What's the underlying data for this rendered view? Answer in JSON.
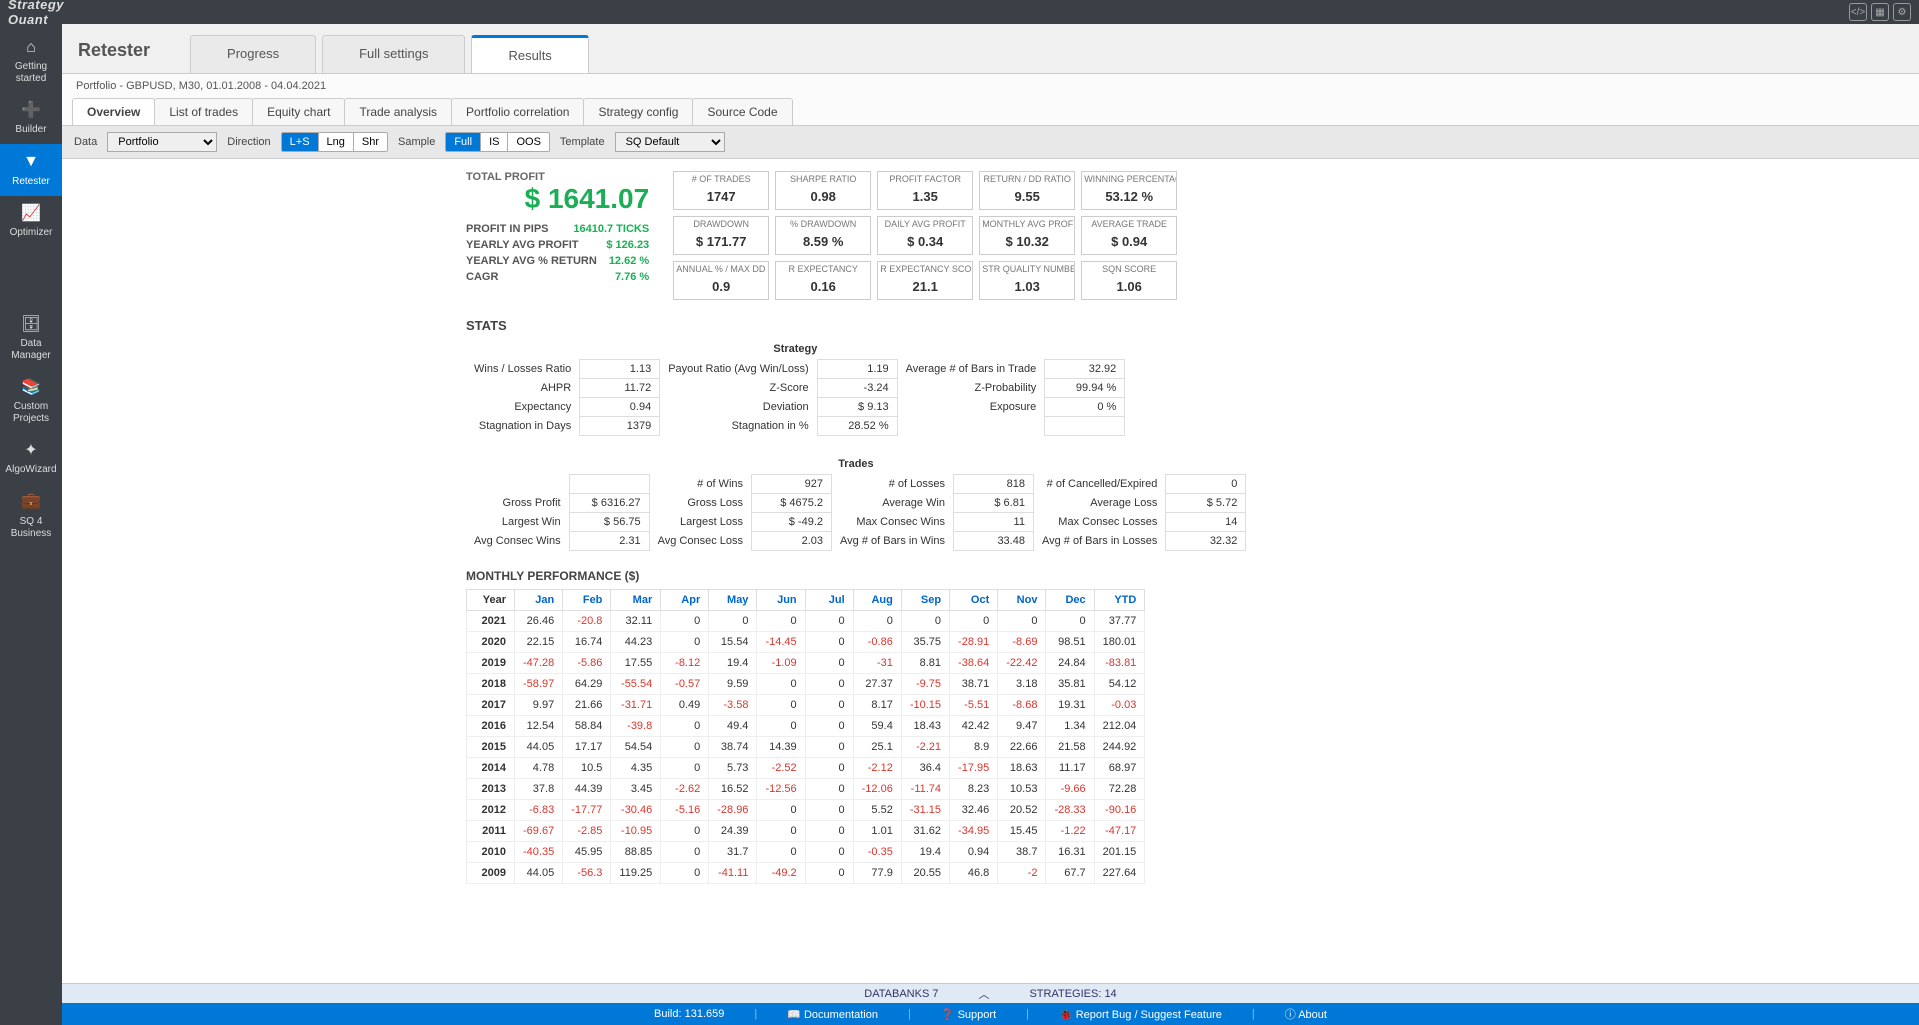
{
  "app": {
    "name": "StrategyQuant"
  },
  "topbar_icons": [
    "code-icon",
    "grid-icon",
    "gear-icon"
  ],
  "sidebar": [
    {
      "icon": "⌂",
      "label": "Getting started"
    },
    {
      "icon": "➕",
      "label": "Builder"
    },
    {
      "icon": "▼",
      "label": "Retester",
      "active": true
    },
    {
      "icon": "📈",
      "label": "Optimizer"
    },
    {
      "spacer": true
    },
    {
      "icon": "🗄",
      "label": "Data Manager"
    },
    {
      "icon": "📚",
      "label": "Custom Projects"
    },
    {
      "icon": "✦",
      "label": "AlgoWizard"
    },
    {
      "icon": "💼",
      "label": "SQ 4 Business"
    }
  ],
  "header": {
    "title": "Retester",
    "module_tabs": [
      "Progress",
      "Full settings",
      "Results"
    ],
    "module_active": 2
  },
  "subtitle": "Portfolio - GBPUSD, M30, 01.01.2008 - 04.04.2021",
  "tabs": [
    "Overview",
    "List of trades",
    "Equity chart",
    "Trade analysis",
    "Portfolio correlation",
    "Strategy config",
    "Source Code"
  ],
  "tab_active": 0,
  "toolbar": {
    "data_label": "Data",
    "data_value": "Portfolio",
    "direction_label": "Direction",
    "direction_opts": [
      "L+S",
      "Lng",
      "Shr"
    ],
    "direction_active": 0,
    "sample_label": "Sample",
    "sample_opts": [
      "Full",
      "IS",
      "OOS"
    ],
    "sample_active": 0,
    "template_label": "Template",
    "template_value": "SQ Default"
  },
  "profit": {
    "total_label": "TOTAL PROFIT",
    "total_value": "$ 1641.07",
    "rows": [
      {
        "label": "PROFIT IN PIPS",
        "val": "16410.7 TICKS"
      },
      {
        "label": "YEARLY AVG PROFIT",
        "val": "$ 126.23"
      },
      {
        "label": "YEARLY AVG % RETURN",
        "val": "12.62 %"
      },
      {
        "label": "CAGR",
        "val": "7.76 %"
      }
    ]
  },
  "info_boxes": [
    [
      {
        "lbl": "# OF TRADES",
        "val": "1747"
      },
      {
        "lbl": "SHARPE RATIO",
        "val": "0.98"
      },
      {
        "lbl": "PROFIT FACTOR",
        "val": "1.35"
      },
      {
        "lbl": "RETURN / DD RATIO",
        "val": "9.55"
      },
      {
        "lbl": "WINNING PERCENTAGE",
        "val": "53.12 %"
      }
    ],
    [
      {
        "lbl": "DRAWDOWN",
        "val": "$ 171.77"
      },
      {
        "lbl": "% DRAWDOWN",
        "val": "8.59 %"
      },
      {
        "lbl": "DAILY AVG PROFIT",
        "val": "$ 0.34"
      },
      {
        "lbl": "MONTHLY AVG PROFIT",
        "val": "$ 10.32"
      },
      {
        "lbl": "AVERAGE TRADE",
        "val": "$ 0.94"
      }
    ],
    [
      {
        "lbl": "ANNUAL % / MAX DD %",
        "val": "0.9"
      },
      {
        "lbl": "R EXPECTANCY",
        "val": "0.16"
      },
      {
        "lbl": "R EXPECTANCY SCORE",
        "val": "21.1"
      },
      {
        "lbl": "STR QUALITY NUMBER",
        "val": "1.03"
      },
      {
        "lbl": "SQN SCORE",
        "val": "1.06"
      }
    ]
  ],
  "stats_title": "STATS",
  "stats_header": "Strategy",
  "stats_rows": [
    [
      {
        "lbl": "Wins / Losses Ratio",
        "val": "1.13"
      },
      {
        "lbl": "Payout Ratio (Avg Win/Loss)",
        "val": "1.19"
      },
      {
        "lbl": "Average # of Bars in Trade",
        "val": "32.92"
      }
    ],
    [
      {
        "lbl": "AHPR",
        "val": "11.72"
      },
      {
        "lbl": "Z-Score",
        "val": "-3.24"
      },
      {
        "lbl": "Z-Probability",
        "val": "99.94 %"
      }
    ],
    [
      {
        "lbl": "Expectancy",
        "val": "0.94"
      },
      {
        "lbl": "Deviation",
        "val": "$ 9.13"
      },
      {
        "lbl": "Exposure",
        "val": "0 %"
      }
    ],
    [
      {
        "lbl": "Stagnation in Days",
        "val": "1379"
      },
      {
        "lbl": "Stagnation in %",
        "val": "28.52 %"
      },
      {
        "lbl": "",
        "val": ""
      }
    ]
  ],
  "trades_header": "Trades",
  "trades_rows": [
    [
      {
        "lbl": "",
        "val": ""
      },
      {
        "lbl": "# of Wins",
        "val": "927"
      },
      {
        "lbl": "# of Losses",
        "val": "818"
      },
      {
        "lbl": "# of Cancelled/Expired",
        "val": "0"
      }
    ],
    [
      {
        "lbl": "Gross Profit",
        "val": "$ 6316.27"
      },
      {
        "lbl": "Gross Loss",
        "val": "$ 4675.2"
      },
      {
        "lbl": "Average Win",
        "val": "$ 6.81"
      },
      {
        "lbl": "Average Loss",
        "val": "$ 5.72"
      }
    ],
    [
      {
        "lbl": "Largest Win",
        "val": "$ 56.75"
      },
      {
        "lbl": "Largest Loss",
        "val": "$ -49.2"
      },
      {
        "lbl": "Max Consec Wins",
        "val": "11"
      },
      {
        "lbl": "Max Consec Losses",
        "val": "14"
      }
    ],
    [
      {
        "lbl": "Avg Consec Wins",
        "val": "2.31"
      },
      {
        "lbl": "Avg Consec Loss",
        "val": "2.03"
      },
      {
        "lbl": "Avg # of Bars in Wins",
        "val": "33.48"
      },
      {
        "lbl": "Avg # of Bars in Losses",
        "val": "32.32"
      }
    ]
  ],
  "monthly_title": "MONTHLY PERFORMANCE ($)",
  "monthly_headers": [
    "Year",
    "Jan",
    "Feb",
    "Mar",
    "Apr",
    "May",
    "Jun",
    "Jul",
    "Aug",
    "Sep",
    "Oct",
    "Nov",
    "Dec",
    "YTD"
  ],
  "monthly_rows": [
    {
      "year": "2021",
      "vals": [
        26.46,
        -20.8,
        32.11,
        0,
        0,
        0,
        0,
        0,
        0,
        0,
        0,
        0,
        37.77
      ]
    },
    {
      "year": "2020",
      "vals": [
        22.15,
        16.74,
        44.23,
        0,
        15.54,
        -14.45,
        0,
        -0.86,
        35.75,
        -28.91,
        -8.69,
        98.51,
        180.01
      ]
    },
    {
      "year": "2019",
      "vals": [
        -47.28,
        -5.86,
        17.55,
        -8.12,
        19.4,
        -1.09,
        0,
        -31,
        8.81,
        -38.64,
        -22.42,
        24.84,
        -83.81
      ]
    },
    {
      "year": "2018",
      "vals": [
        -58.97,
        64.29,
        -55.54,
        -0.57,
        9.59,
        0,
        0,
        27.37,
        -9.75,
        38.71,
        3.18,
        35.81,
        54.12
      ]
    },
    {
      "year": "2017",
      "vals": [
        9.97,
        21.66,
        -31.71,
        0.49,
        -3.58,
        0,
        0,
        8.17,
        -10.15,
        -5.51,
        -8.68,
        19.31,
        -0.03
      ]
    },
    {
      "year": "2016",
      "vals": [
        12.54,
        58.84,
        -39.8,
        0,
        49.4,
        0,
        0,
        59.4,
        18.43,
        42.42,
        9.47,
        1.34,
        212.04
      ]
    },
    {
      "year": "2015",
      "vals": [
        44.05,
        17.17,
        54.54,
        0,
        38.74,
        14.39,
        0,
        25.1,
        -2.21,
        8.9,
        22.66,
        21.58,
        244.92
      ]
    },
    {
      "year": "2014",
      "vals": [
        4.78,
        10.5,
        4.35,
        0,
        5.73,
        -2.52,
        0,
        -2.12,
        36.4,
        -17.95,
        18.63,
        11.17,
        68.97
      ]
    },
    {
      "year": "2013",
      "vals": [
        37.8,
        44.39,
        3.45,
        -2.62,
        16.52,
        -12.56,
        0,
        -12.06,
        -11.74,
        8.23,
        10.53,
        -9.66,
        72.28
      ]
    },
    {
      "year": "2012",
      "vals": [
        -6.83,
        -17.77,
        -30.46,
        -5.16,
        -28.96,
        0,
        0,
        5.52,
        -31.15,
        32.46,
        20.52,
        -28.33,
        -90.16
      ]
    },
    {
      "year": "2011",
      "vals": [
        -69.67,
        -2.85,
        -10.95,
        0,
        24.39,
        0,
        0,
        1.01,
        31.62,
        -34.95,
        15.45,
        -1.22,
        -47.17
      ]
    },
    {
      "year": "2010",
      "vals": [
        -40.35,
        45.95,
        88.85,
        0,
        31.7,
        0,
        0,
        -0.35,
        19.4,
        0.94,
        38.7,
        16.31,
        201.15
      ]
    },
    {
      "year": "2009",
      "vals": [
        44.05,
        -56.3,
        119.25,
        0,
        -41.11,
        -49.2,
        0,
        77.9,
        20.55,
        46.8,
        -2,
        67.7,
        227.64
      ]
    }
  ],
  "databanks": {
    "left": "DATABANKS 7",
    "right": "STRATEGIES: 14"
  },
  "footer": {
    "build": "Build: 131.659",
    "items": [
      "Documentation",
      "Support",
      "Report Bug / Suggest Feature",
      "About"
    ]
  }
}
